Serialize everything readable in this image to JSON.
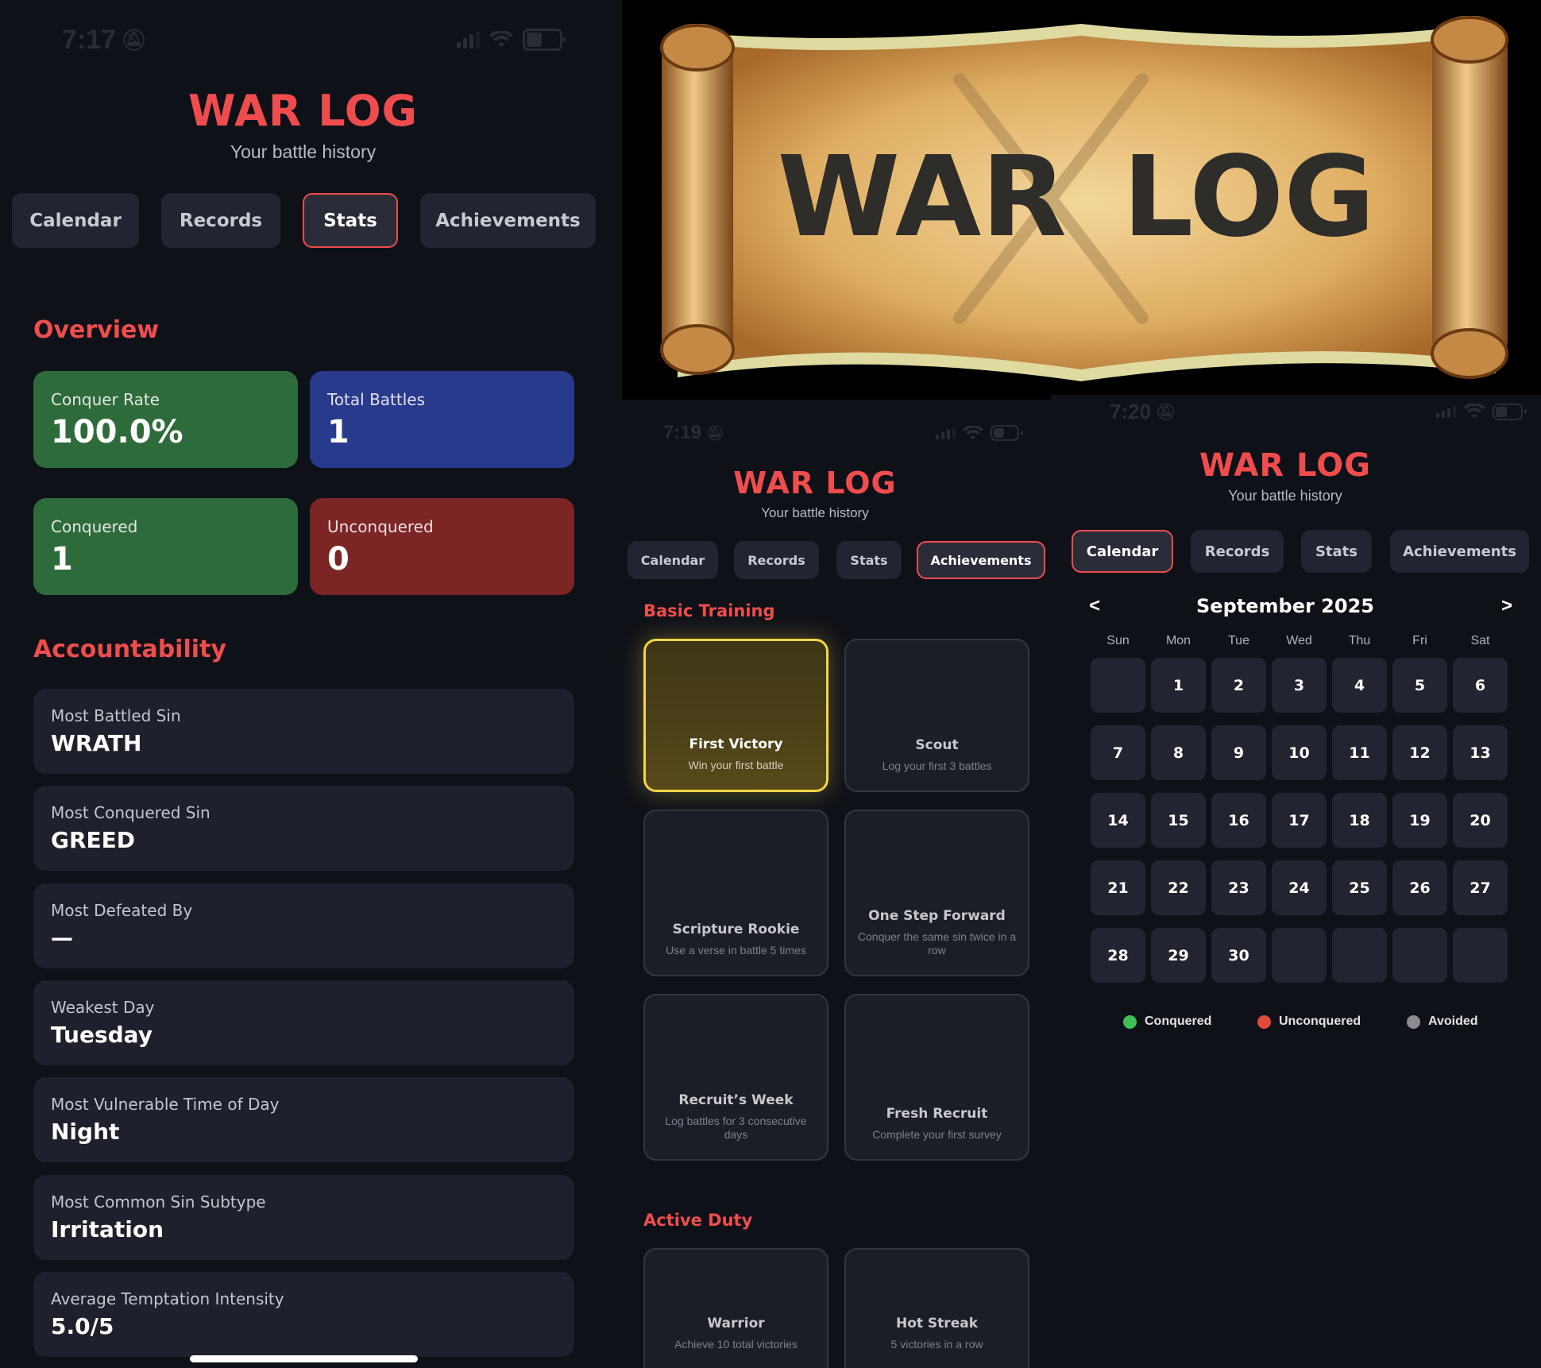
{
  "app": {
    "title": "WAR LOG",
    "subtitle": "Your battle history"
  },
  "tabs": [
    "Calendar",
    "Records",
    "Stats",
    "Achievements"
  ],
  "stats_screen": {
    "status_time": "7:17",
    "active_tab": "Stats",
    "battery": "47",
    "overview": {
      "title": "Overview",
      "cards": [
        {
          "label": "Conquer Rate",
          "value": "100.0%",
          "color": "#2e6b3a"
        },
        {
          "label": "Total Battles",
          "value": "1",
          "color": "#283a8c"
        },
        {
          "label": "Conquered",
          "value": "1",
          "color": "#2e6b3a"
        },
        {
          "label": "Unconquered",
          "value": "0",
          "color": "#7b2525"
        }
      ]
    },
    "accountability": {
      "title": "Accountability",
      "items": [
        {
          "label": "Most Battled Sin",
          "value": "WRATH"
        },
        {
          "label": "Most Conquered Sin",
          "value": "GREED"
        },
        {
          "label": "Most Defeated By",
          "value": "—"
        },
        {
          "label": "Weakest Day",
          "value": "Tuesday"
        },
        {
          "label": "Most Vulnerable Time of Day",
          "value": "Night"
        },
        {
          "label": "Most Common Sin Subtype",
          "value": "Irritation"
        },
        {
          "label": "Average Temptation Intensity",
          "value": "5.0/5"
        }
      ]
    }
  },
  "banner": {
    "text_left": "WAR",
    "text_right": "LOG"
  },
  "achievements_screen": {
    "status_time": "7:19",
    "active_tab": "Achievements",
    "sections": [
      {
        "title": "Basic Training",
        "items": [
          {
            "title": "First Victory",
            "desc": "Win your first battle",
            "earned": true
          },
          {
            "title": "Scout",
            "desc": "Log your first 3 battles",
            "earned": false
          },
          {
            "title": "Scripture Rookie",
            "desc": "Use a verse in battle 5 times",
            "earned": false
          },
          {
            "title": "One Step Forward",
            "desc": "Conquer the same sin twice in a row",
            "earned": false
          },
          {
            "title": "Recruit’s Week",
            "desc": "Log battles for 3 consecutive days",
            "earned": false
          },
          {
            "title": "Fresh Recruit",
            "desc": "Complete your first survey",
            "earned": false
          }
        ]
      },
      {
        "title": "Active Duty",
        "items": [
          {
            "title": "Warrior",
            "desc": "Achieve 10 total victories",
            "earned": false
          },
          {
            "title": "Hot Streak",
            "desc": "5 victories in a row",
            "earned": false
          }
        ]
      }
    ]
  },
  "calendar_screen": {
    "status_time": "7:20",
    "active_tab": "Calendar",
    "month_label": "September 2025",
    "prev": "<",
    "next": ">",
    "weekdays": [
      "Sun",
      "Mon",
      "Tue",
      "Wed",
      "Thu",
      "Fri",
      "Sat"
    ],
    "days": [
      "",
      "1",
      "2",
      "3",
      "4",
      "5",
      "6",
      "7",
      "8",
      "9",
      "10",
      "11",
      "12",
      "13",
      "14",
      "15",
      "16",
      "17",
      "18",
      "19",
      "20",
      "21",
      "22",
      "23",
      "24",
      "25",
      "26",
      "27",
      "28",
      "29",
      "30",
      "",
      "",
      "",
      ""
    ],
    "legend": [
      {
        "label": "Conquered",
        "color": "#3fbf55"
      },
      {
        "label": "Unconquered",
        "color": "#e14b3b"
      },
      {
        "label": "Avoided",
        "color": "#8a8c90"
      }
    ]
  }
}
